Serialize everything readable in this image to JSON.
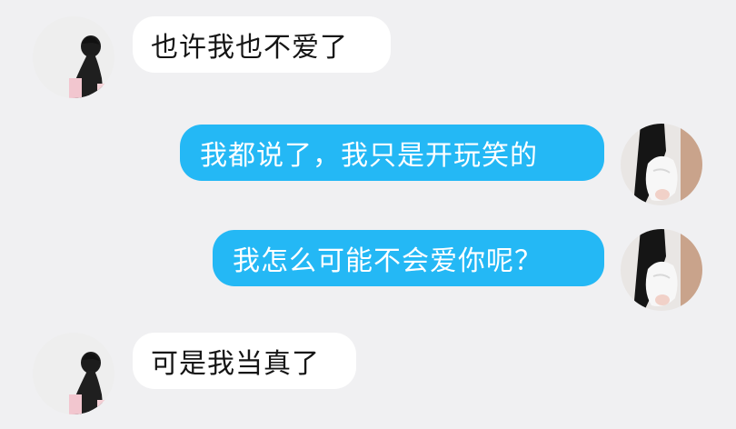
{
  "messages": [
    {
      "side": "incoming",
      "text": "也许我也不爱了",
      "avatar": "avatar-girl-dark-hair"
    },
    {
      "side": "outgoing",
      "text": "我都说了，我只是开玩笑的",
      "avatar": "avatar-girl-white-outfit"
    },
    {
      "side": "outgoing",
      "text": "我怎么可能不会爱你呢？",
      "avatar": "avatar-girl-white-outfit"
    },
    {
      "side": "incoming",
      "text": "可是我当真了",
      "avatar": "avatar-girl-dark-hair"
    }
  ],
  "colors": {
    "background": "#f0f0f2",
    "incoming_bubble": "#ffffff",
    "outgoing_bubble": "#24b8f5",
    "incoming_text": "#151515",
    "outgoing_text": "#ffffff"
  }
}
